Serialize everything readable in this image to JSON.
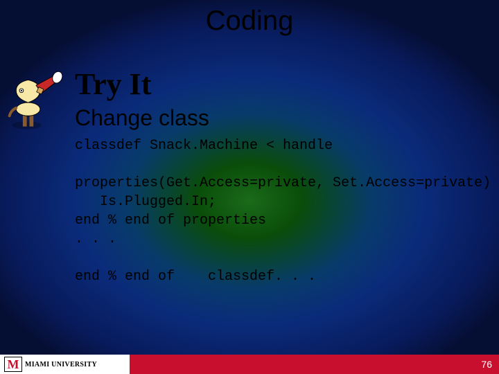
{
  "title": "Coding",
  "tryit_label": "Try It",
  "subtitle": "Change class",
  "code": {
    "line1": "classdef Snack.Machine < handle",
    "line2": "",
    "line3": "properties(Get.Access=private, Set.Access=private)",
    "line4": "   Is.Plugged.In;",
    "line5": "end % end of properties",
    "line6": ". . .",
    "line7": "",
    "line8": "end % end of    classdef. . ."
  },
  "footer": {
    "logo_letter": "M",
    "university_top": "MIAMI UNIVERSITY",
    "university_bottom": "",
    "page_number": "76"
  }
}
